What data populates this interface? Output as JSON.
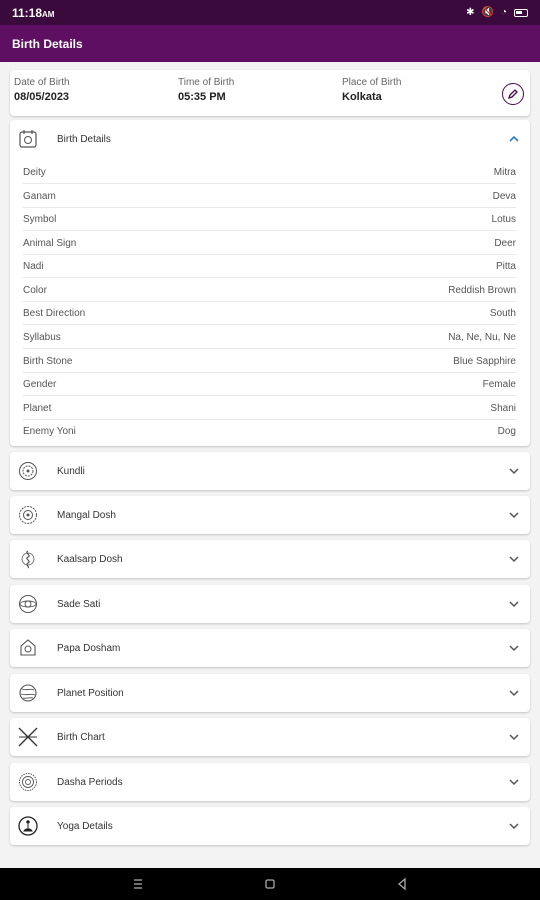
{
  "status": {
    "time": "11:18",
    "suffix": "AM"
  },
  "app_bar": {
    "title": "Birth Details"
  },
  "info": {
    "dob_label": "Date of Birth",
    "dob_value": "08/05/2023",
    "tob_label": "Time of Birth",
    "tob_value": "05:35 PM",
    "pob_label": "Place of Birth",
    "pob_value": "Kolkata"
  },
  "birth_details": {
    "title": "Birth Details",
    "rows": [
      {
        "key": "Deity",
        "value": "Mitra"
      },
      {
        "key": "Ganam",
        "value": "Deva"
      },
      {
        "key": "Symbol",
        "value": "Lotus"
      },
      {
        "key": "Animal Sign",
        "value": "Deer"
      },
      {
        "key": "Nadi",
        "value": "Pitta"
      },
      {
        "key": "Color",
        "value": "Reddish Brown"
      },
      {
        "key": "Best Direction",
        "value": "South"
      },
      {
        "key": "Syllabus",
        "value": "Na, Ne, Nu, Ne"
      },
      {
        "key": "Birth Stone",
        "value": "Blue Sapphire"
      },
      {
        "key": "Gender",
        "value": "Female"
      },
      {
        "key": "Planet",
        "value": "Shani"
      },
      {
        "key": "Enemy Yoni",
        "value": "Dog"
      }
    ]
  },
  "sections": [
    {
      "title": "Kundli",
      "icon": "kundli-icon"
    },
    {
      "title": "Mangal Dosh",
      "icon": "mangal-icon"
    },
    {
      "title": "Kaalsarp Dosh",
      "icon": "kaalsarp-icon"
    },
    {
      "title": "Sade Sati",
      "icon": "sadesati-icon"
    },
    {
      "title": "Papa Dosham",
      "icon": "papa-icon"
    },
    {
      "title": "Planet Position",
      "icon": "planet-icon"
    },
    {
      "title": "Birth Chart",
      "icon": "birthchart-icon"
    },
    {
      "title": "Dasha Periods",
      "icon": "dasha-icon"
    },
    {
      "title": "Yoga Details",
      "icon": "yoga-icon"
    }
  ],
  "colors": {
    "status_bar": "#3a0a3c",
    "app_bar": "#5e0f61",
    "accent": "#4a0a4f",
    "chevron_up": "#2a7bd4"
  }
}
